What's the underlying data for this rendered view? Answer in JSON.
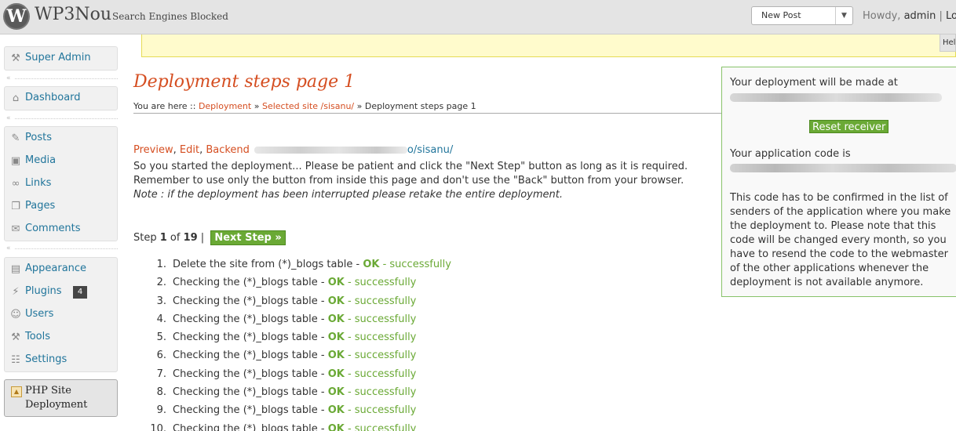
{
  "header": {
    "logo_glyph": "W",
    "site_title": "WP3Nou",
    "site_visibility": "Search Engines Blocked",
    "favorite_action": "New Post",
    "howdy": "Howdy, ",
    "user": "admin",
    "separator": " | ",
    "logout": "Log Out"
  },
  "help_tab": "Help",
  "sidebar": {
    "super_admin": "Super Admin",
    "dashboard": "Dashboard",
    "posts": "Posts",
    "media": "Media",
    "links": "Links",
    "pages": "Pages",
    "comments": "Comments",
    "appearance": "Appearance",
    "plugins": "Plugins",
    "plugins_badge": "4",
    "users": "Users",
    "tools": "Tools",
    "settings": "Settings",
    "php_site_deployment": "PHP Site Deployment"
  },
  "main": {
    "title": "Deployment steps page 1",
    "breadcrumb": {
      "prefix": "You are here :: ",
      "items": [
        "Deployment",
        "Selected site /sisanu/"
      ],
      "sep": " » ",
      "current": "Deployment steps page 1"
    },
    "links": {
      "preview": "Preview",
      "comma1": ", ",
      "edit": "Edit",
      "comma2": ", ",
      "backend": "Backend",
      "url_suffix": "o/sisanu/"
    },
    "intro_text": "So you started the deployment... Please be patient and click the \"Next Step\" button as long as it is required. Remember to use only the button from inside this page and don't use the \"Back\" button from your browser.",
    "intro_note": "Note : if the deployment has been interrupted please retake the entire deployment.",
    "step": {
      "prefix": "Step ",
      "current": "1",
      "of": " of ",
      "total": "19",
      "sep": " | ",
      "next_label": "Next Step »"
    },
    "steps": [
      {
        "num": "1.",
        "text": "Delete the site from (*)_blogs table - ",
        "ok": "OK",
        "status": " - successfully"
      },
      {
        "num": "2.",
        "text": "Checking the (*)_blogs table - ",
        "ok": "OK",
        "status": " - successfully"
      },
      {
        "num": "3.",
        "text": "Checking the (*)_blogs table - ",
        "ok": "OK",
        "status": " - successfully"
      },
      {
        "num": "4.",
        "text": "Checking the (*)_blogs table - ",
        "ok": "OK",
        "status": " - successfully"
      },
      {
        "num": "5.",
        "text": "Checking the (*)_blogs table - ",
        "ok": "OK",
        "status": " - successfully"
      },
      {
        "num": "6.",
        "text": "Checking the (*)_blogs table - ",
        "ok": "OK",
        "status": " - successfully"
      },
      {
        "num": "7.",
        "text": "Checking the (*)_blogs table - ",
        "ok": "OK",
        "status": " - successfully"
      },
      {
        "num": "8.",
        "text": "Checking the (*)_blogs table - ",
        "ok": "OK",
        "status": " - successfully"
      },
      {
        "num": "9.",
        "text": "Checking the (*)_blogs table - ",
        "ok": "OK",
        "status": " - successfully"
      },
      {
        "num": "10.",
        "text": "Checking the (*)_blogs table - ",
        "ok": "OK",
        "status": " - successfully"
      }
    ]
  },
  "info_panel": {
    "deploy_label": "Your deployment will be made at",
    "reset_button": "Reset receiver",
    "code_label": "Your application code is",
    "code_note": "This code has to be confirmed in the list of senders of the application where you make the deployment to. Please note that this code will be changed every month, so you have to resend the code to the webmaster of the other applications whenever the deployment is not available anymore."
  },
  "colors": {
    "accent_orange": "#d54e21",
    "link_blue": "#21759b",
    "ok_green": "#6aa935",
    "notice_yellow": "#fffbcc"
  },
  "icons": {
    "logo": "wordpress-logo-icon",
    "super_admin": "super-admin-icon",
    "dashboard": "dashboard-icon",
    "posts": "pushpin-icon",
    "media": "media-icon",
    "links": "link-icon",
    "pages": "pages-icon",
    "comments": "comment-icon",
    "appearance": "appearance-icon",
    "plugins": "plug-icon",
    "users": "users-icon",
    "tools": "tools-icon",
    "settings": "settings-icon",
    "php": "php-deployment-icon"
  }
}
